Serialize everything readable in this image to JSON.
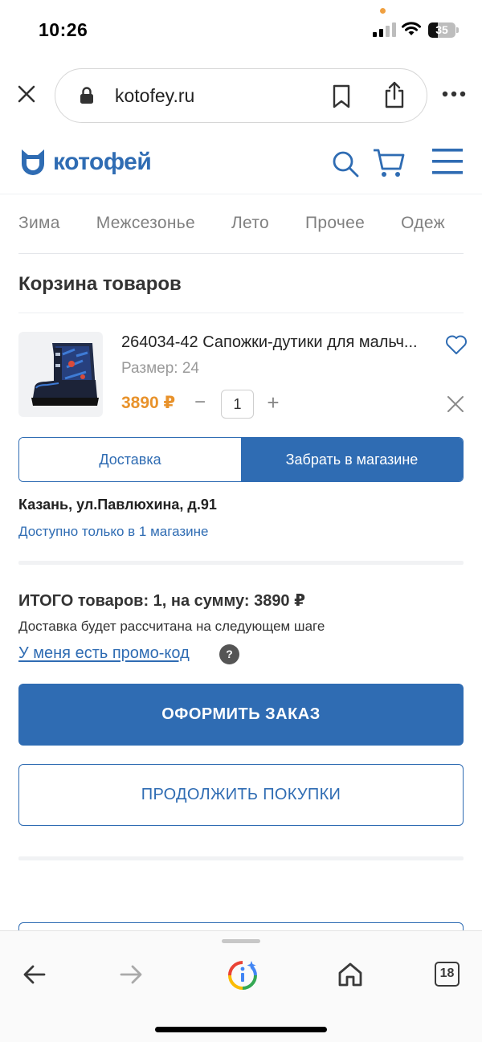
{
  "status_bar": {
    "time": "10:26",
    "battery": "35",
    "battery_level": 0.35
  },
  "browser": {
    "url": "kotofey.ru"
  },
  "site": {
    "logo_text": "котофей",
    "brand_color": "#2f6cb3",
    "price_color": "#e8922b"
  },
  "categories": [
    "Зима",
    "Межсезонье",
    "Лето",
    "Прочее",
    "Одеж"
  ],
  "cart": {
    "title": "Корзина товаров",
    "item": {
      "name": "264034-42 Сапожки-дутики для мальч...",
      "size": "Размер: 24",
      "price": "3890 ₽",
      "qty_minus": "−",
      "qty": "1",
      "qty_plus": "+"
    },
    "delivery_options": [
      "Доставка",
      "Забрать в магазине"
    ],
    "selected_option": "Забрать в магазине",
    "store_address": "Казань, ул.Павлюхина, д.91",
    "store_availability": "Доступно только в 1 магазине",
    "total": "ИТОГО товаров: 1, на сумму: 3890 ₽",
    "delivery_note": "Доставка будет рассчитана на следующем шаге",
    "promo_link": "У меня есть промо-код",
    "help": "?",
    "checkout_label": "ОФОРМИТЬ ЗАКАЗ",
    "continue_label": "ПРОДОЛЖИТЬ ПОКУПКИ"
  },
  "toolbar": {
    "tabs_count": "18"
  }
}
